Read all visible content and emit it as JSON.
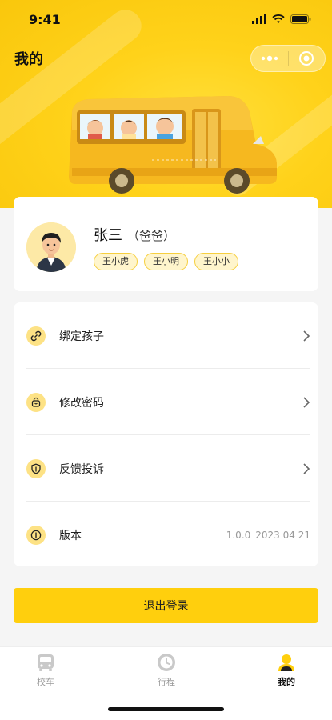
{
  "status_bar": {
    "time": "9:41"
  },
  "header": {
    "title": "我的"
  },
  "profile": {
    "name": "张三",
    "role": "（爸爸）",
    "children": [
      "王小虎",
      "王小明",
      "王小小"
    ]
  },
  "menu": {
    "items": [
      {
        "label": "绑定孩子",
        "icon": "link-icon"
      },
      {
        "label": "修改密码",
        "icon": "lock-icon"
      },
      {
        "label": "反馈投诉",
        "icon": "shield-icon"
      },
      {
        "label": "版本",
        "icon": "info-icon"
      }
    ],
    "version": "1.0.0",
    "version_date": "2023 04 21"
  },
  "logout_label": "退出登录",
  "tabbar": {
    "items": [
      {
        "label": "校车",
        "icon": "bus-icon",
        "active": false
      },
      {
        "label": "行程",
        "icon": "clock-icon",
        "active": false
      },
      {
        "label": "我的",
        "icon": "user-icon",
        "active": true
      }
    ]
  },
  "colors": {
    "accent": "#ffcf0d",
    "tag_bg": "#fff5cc",
    "icon_bg": "#fde285"
  }
}
